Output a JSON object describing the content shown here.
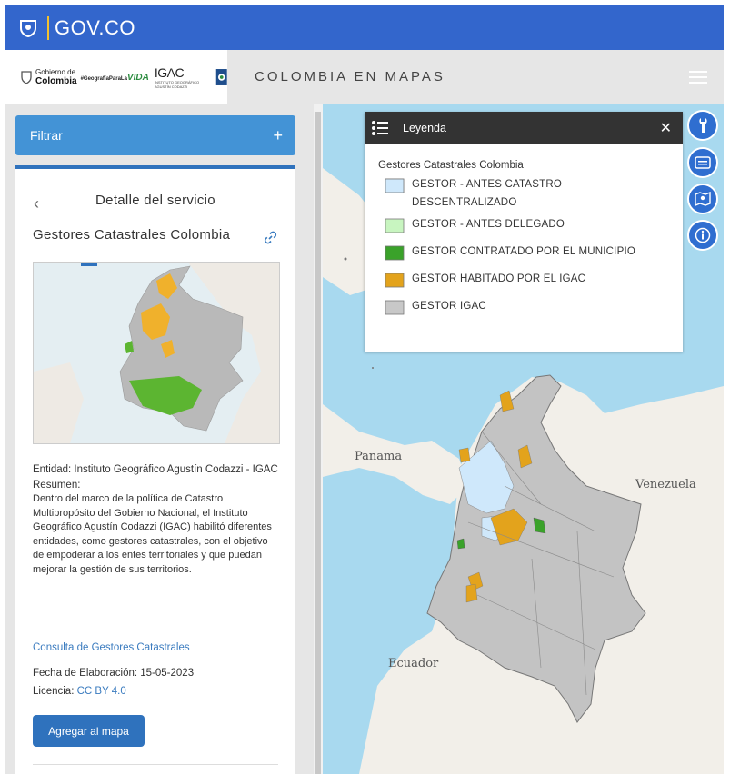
{
  "gov_bar": {
    "brand": "GOV.CO"
  },
  "header": {
    "logo_gobierno_line1": "Gobierno de",
    "logo_gobierno_line2": "Colombia",
    "logo_geografia": "#GeografíaParaLa",
    "logo_geografia_vida": "VIDA",
    "logo_igac": "IGAC",
    "logo_igac_sub": "INSTITUTO GEOGRÁFICO AGUSTÍN CODAZZI",
    "app_title": "COLOMBIA EN MAPAS"
  },
  "sidebar": {
    "filter_label": "Filtrar",
    "filter_toggle": "+",
    "back_glyph": "‹",
    "detail_title": "Detalle del servicio",
    "service_name": "Gestores Catastrales Colombia",
    "entidad": "Entidad: Instituto Geográfico Agustín Codazzi - IGAC",
    "resumen_label": "Resumen:",
    "resumen_text": "Dentro del marco de la política de Catastro Multipropósito del Gobierno Nacional, el Instituto Geográfico Agustín Codazzi (IGAC) habilitó diferentes entidades, como gestores catastrales, con el objetivo de empoderar a los entes territoriales y que puedan mejorar la gestión de sus territorios.",
    "consulta_link": "Consulta de Gestores Catastrales",
    "fecha": "Fecha de Elaboración: 15-05-2023",
    "licencia_label": "Licencia:",
    "licencia_value": "CC BY 4.0",
    "add_button": "Agregar al mapa"
  },
  "legend": {
    "title": "Leyenda",
    "close_glyph": "✕",
    "layer_name": "Gestores Catastrales Colombia",
    "items": [
      {
        "label": "GESTOR - ANTES CATASTRO DESCENTRALIZADO",
        "color": "#cfe8fb"
      },
      {
        "label": "GESTOR - ANTES DELEGADO",
        "color": "#c8f5c0"
      },
      {
        "label": "GESTOR CONTRATADO POR EL MUNICIPIO",
        "color": "#3aa22a"
      },
      {
        "label": "GESTOR HABITADO POR EL IGAC",
        "color": "#e3a31c"
      },
      {
        "label": "GESTOR IGAC",
        "color": "#c8c8c8"
      }
    ]
  },
  "map": {
    "labels": {
      "panama": "Panama",
      "venezuela": "Venezuela",
      "ecuador": "Ecuador"
    },
    "tools": [
      "wrench-icon",
      "layers-window-icon",
      "map-icon",
      "info-icon"
    ]
  },
  "colors": {
    "gov_blue": "#3366cc",
    "accent_blue": "#2f72bd",
    "filter_blue": "#4393d6",
    "sea": "#a8d9ef",
    "land": "#f2efe9"
  }
}
